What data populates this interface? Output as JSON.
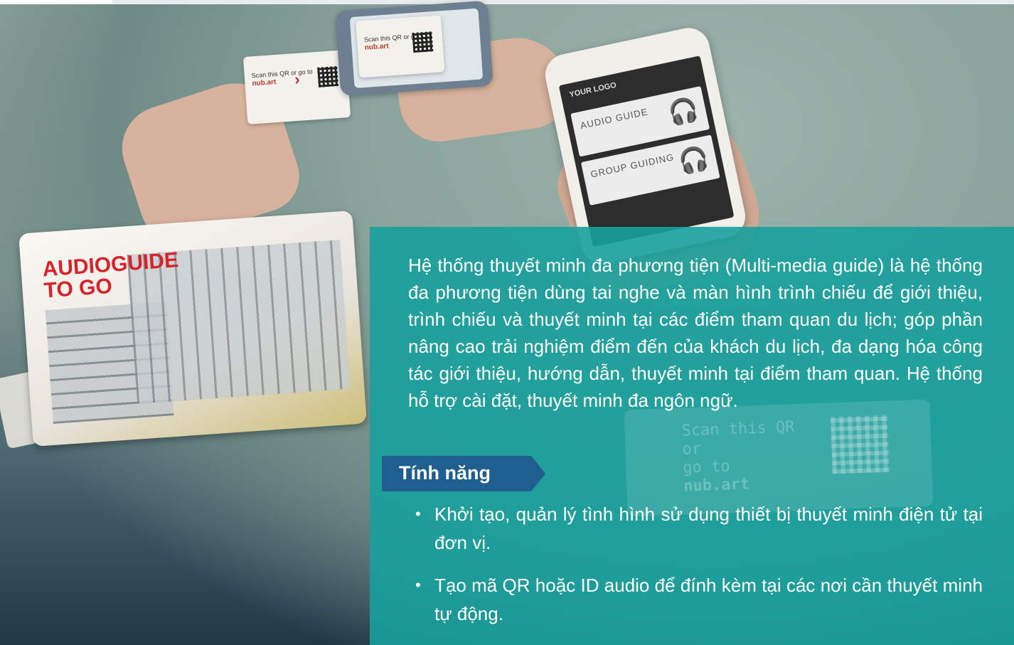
{
  "description": "Hệ thống thuyết minh đa phương tiện (Multi-media guide) là hệ thống đa phương tiện dùng tai nghe và màn hình trình chiếu để giới thiệu, trình chiếu và thuyết minh tại các điểm tham quan du lịch; góp phần nâng cao trải nghiệm điểm đến của khách du lịch, đa dạng hóa công tác giới thiệu, hướng dẫn, thuyết minh tại điểm tham quan. Hệ thống hỗ trợ cài đặt, thuyết minh đa ngôn ngữ.",
  "features_heading": "Tính năng",
  "features": [
    "Khởi tạo, quản lý tình hình sử dụng thiết bị thuyết minh điện tử tại đơn vị.",
    "Tạo mã QR hoặc ID audio để đính kèm tại các nơi cần thuyết minh tự động."
  ],
  "image_text": {
    "card_title": "AUDIOGUIDE\nTO GO",
    "phone_audio": "AUDIO GUIDE",
    "phone_group": "GROUP GUIDING",
    "phone_logo": "YOUR LOGO",
    "scan_text": "Scan this QR or go to",
    "scan_url": "nub.art"
  },
  "colors": {
    "panel": "#17a09c",
    "tag": "#1e5f8f",
    "card_title": "#d6232a"
  }
}
